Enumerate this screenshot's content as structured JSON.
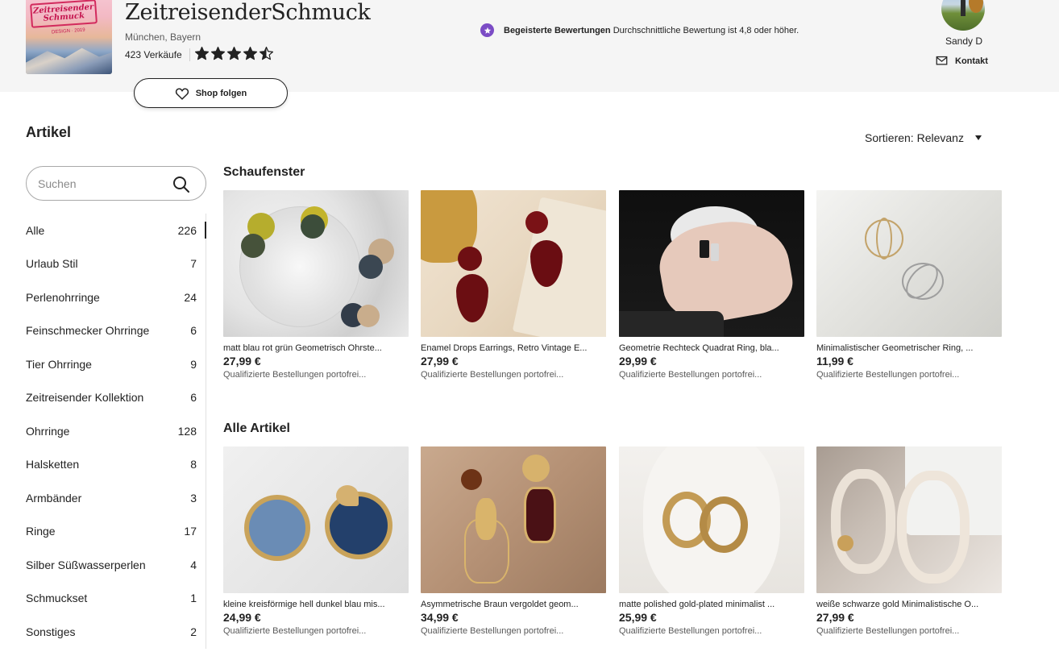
{
  "header": {
    "logo_text_line1": "Zeitreisender",
    "logo_text_line2": "Schmuck",
    "logo_text_sub": "DESIGN · 2019",
    "shop_name": "ZeitreisenderSchmuck",
    "location": "München, Bayern",
    "sales": "423 Verkäufe",
    "rating": 4.5,
    "rating_max": 5,
    "follow_label": "Shop folgen",
    "badge_bold": "Begeisterte Bewertungen",
    "badge_text": "Durchschnittliche Bewertung ist 4,8 oder höher.",
    "owner_name": "Sandy D",
    "contact_label": "Kontakt"
  },
  "sidebar": {
    "title": "Artikel",
    "search_placeholder": "Suchen",
    "categories": [
      {
        "label": "Alle",
        "count": "226"
      },
      {
        "label": "Urlaub Stil",
        "count": "7"
      },
      {
        "label": "Perlenohrringe",
        "count": "24"
      },
      {
        "label": "Feinschmecker Ohrringe",
        "count": "6"
      },
      {
        "label": "Tier Ohrringe",
        "count": "9"
      },
      {
        "label": "Zeitreisender Kollektion",
        "count": "6"
      },
      {
        "label": "Ohrringe",
        "count": "128"
      },
      {
        "label": "Halsketten",
        "count": "8"
      },
      {
        "label": "Armbänder",
        "count": "3"
      },
      {
        "label": "Ringe",
        "count": "17"
      },
      {
        "label": "Silber Süßwasserperlen",
        "count": "4"
      },
      {
        "label": "Schmuckset",
        "count": "1"
      },
      {
        "label": "Sonstiges",
        "count": "2"
      }
    ]
  },
  "sort": {
    "label": "Sortieren: Relevanz"
  },
  "showcase": {
    "title": "Schaufenster",
    "items": [
      {
        "title": "matt blau rot grün Geometrisch Ohrste...",
        "price": "27,99 €",
        "shipping": "Qualifizierte Bestellungen portofrei..."
      },
      {
        "title": "Enamel Drops Earrings, Retro Vintage E...",
        "price": "27,99 €",
        "shipping": "Qualifizierte Bestellungen portofrei..."
      },
      {
        "title": "Geometrie Rechteck Quadrat Ring, bla...",
        "price": "29,99 €",
        "shipping": "Qualifizierte Bestellungen portofrei..."
      },
      {
        "title": "Minimalistischer Geometrischer Ring, ...",
        "price": "11,99 €",
        "shipping": "Qualifizierte Bestellungen portofrei..."
      }
    ]
  },
  "all_items": {
    "title": "Alle Artikel",
    "items": [
      {
        "title": "kleine kreisförmige hell dunkel blau mis...",
        "price": "24,99 €",
        "shipping": "Qualifizierte Bestellungen portofrei..."
      },
      {
        "title": "Asymmetrische Braun vergoldet geom...",
        "price": "34,99 €",
        "shipping": "Qualifizierte Bestellungen portofrei..."
      },
      {
        "title": "matte polished gold-plated minimalist ...",
        "price": "25,99 €",
        "shipping": "Qualifizierte Bestellungen portofrei..."
      },
      {
        "title": "weiße schwarze gold Minimalistische O...",
        "price": "27,99 €",
        "shipping": "Qualifizierte Bestellungen portofrei..."
      }
    ]
  },
  "colors": {
    "accent_purple": "#7b4cc5",
    "text": "#222222",
    "muted": "#595959",
    "header_bg": "#f5f5f5"
  }
}
